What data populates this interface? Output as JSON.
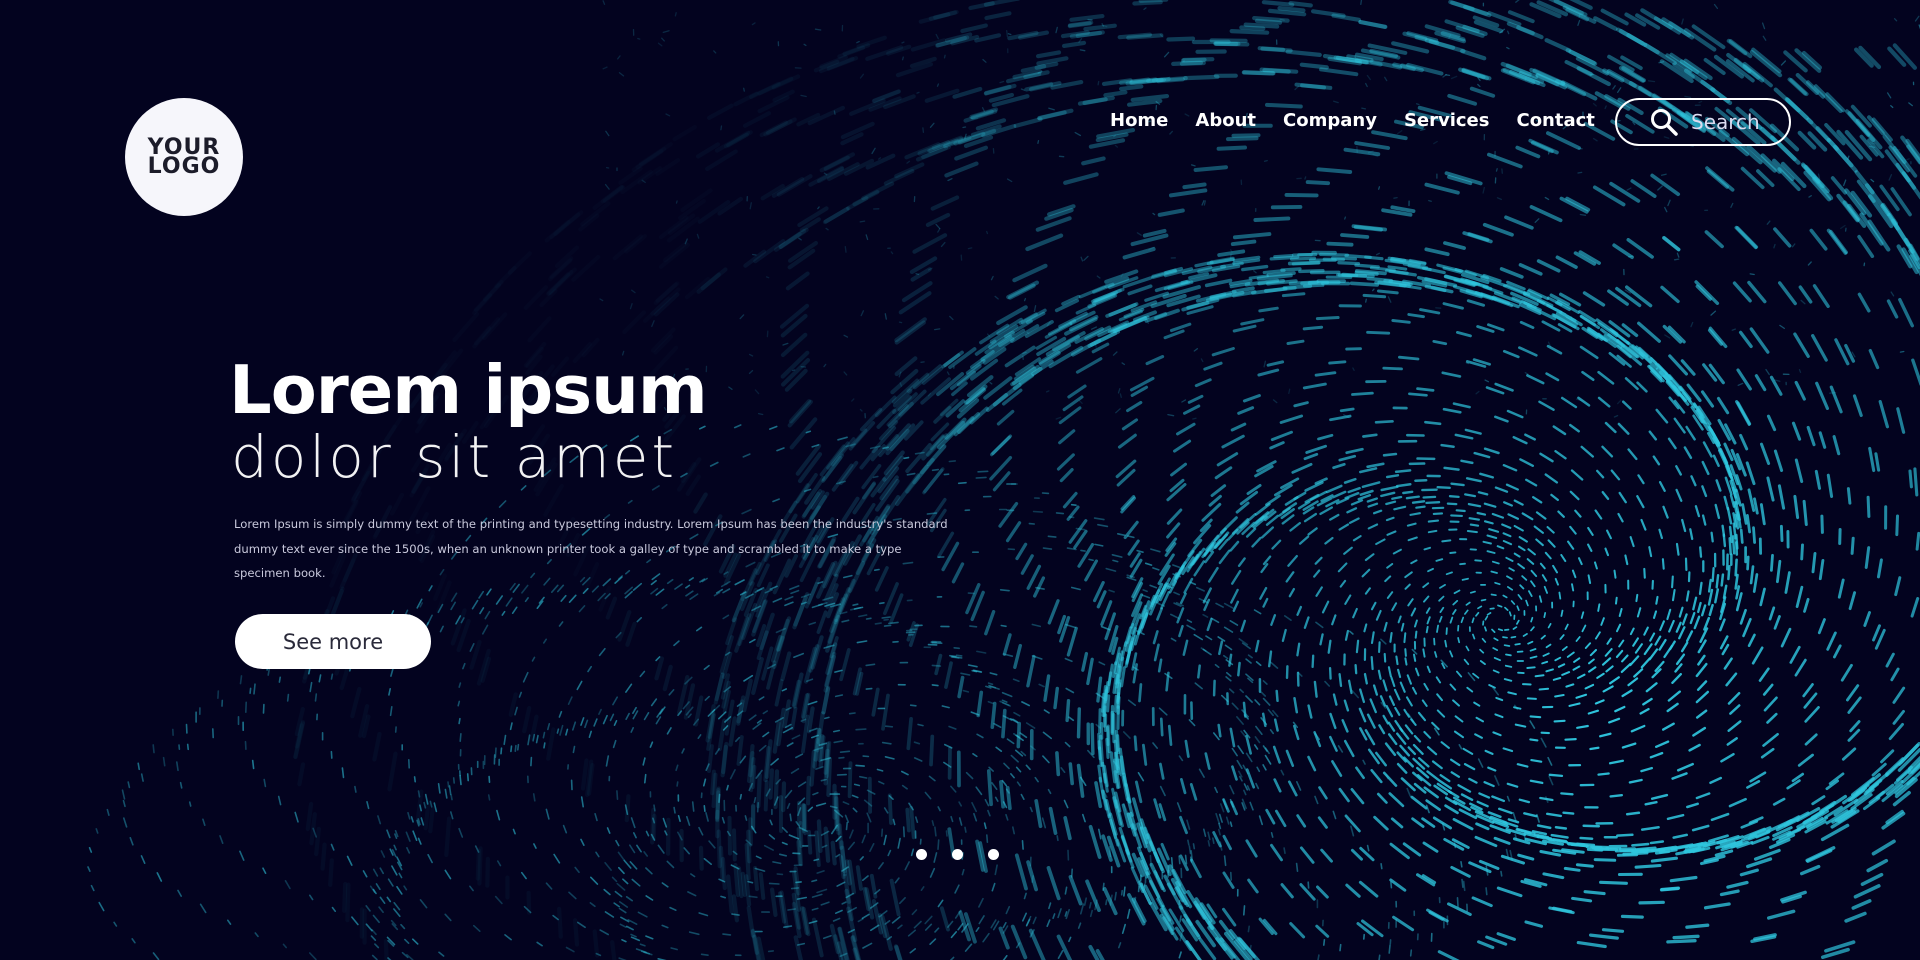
{
  "brand": {
    "logo_line1": "YOUR",
    "logo_line2": "LOGO"
  },
  "nav": {
    "items": [
      {
        "label": "Home"
      },
      {
        "label": "About"
      },
      {
        "label": "Company"
      },
      {
        "label": "Services"
      },
      {
        "label": "Contact"
      }
    ]
  },
  "search": {
    "placeholder": "Search",
    "icon": "search-icon"
  },
  "hero": {
    "title": "Lorem ipsum",
    "subtitle": "dolor sit amet",
    "body": "Lorem Ipsum is simply dummy text of the printing and typesetting industry. Lorem Ipsum has been the industry's standard dummy text ever since the 1500s, when an unknown printer took a galley of type and scrambled it to make a type specimen book.",
    "cta_label": "See more"
  },
  "slider": {
    "dot_count": 3
  },
  "colors": {
    "background": "#03031f",
    "accent": "#2fc6de",
    "text": "#ffffff"
  }
}
